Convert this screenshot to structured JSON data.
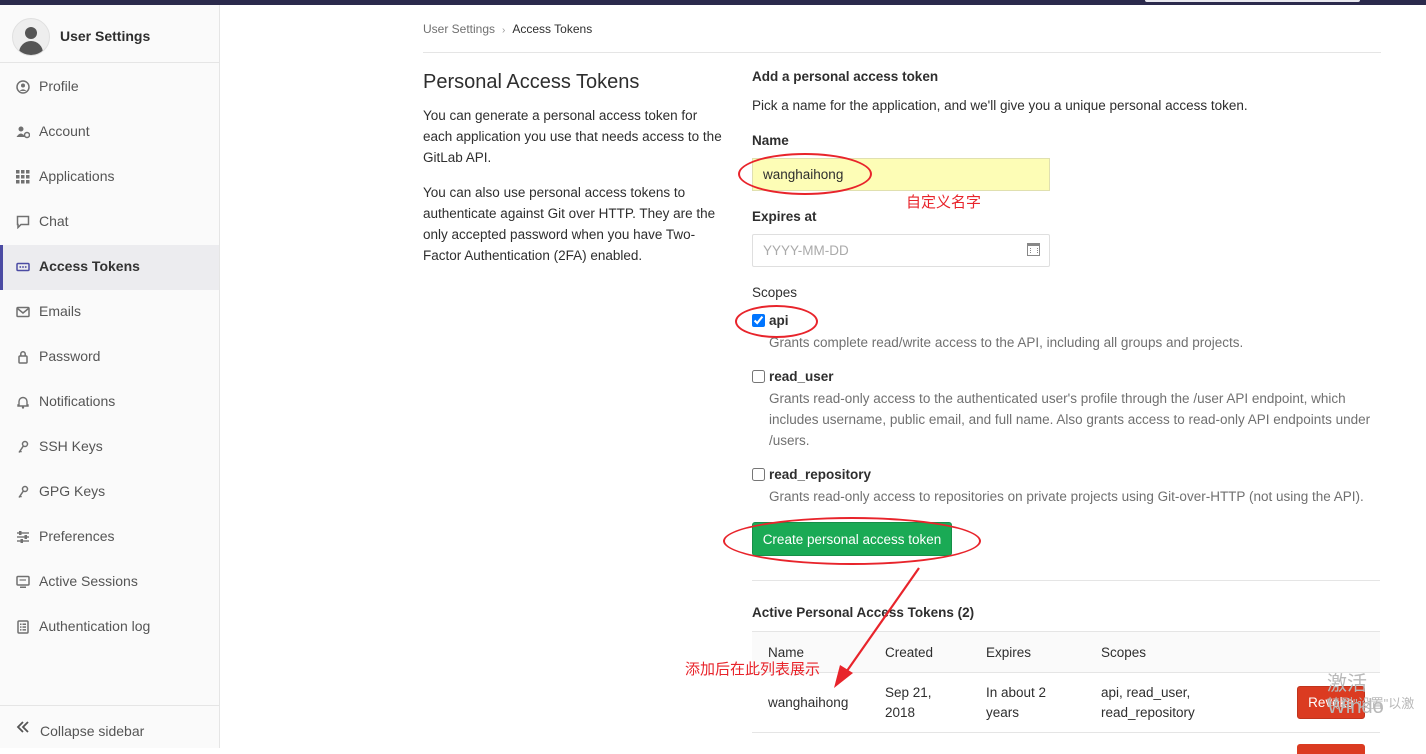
{
  "sidebar": {
    "title": "User Settings",
    "items": [
      {
        "label": "Profile",
        "icon": "user-circle-icon"
      },
      {
        "label": "Account",
        "icon": "users-gear-icon"
      },
      {
        "label": "Applications",
        "icon": "grid-icon"
      },
      {
        "label": "Chat",
        "icon": "comment-icon"
      },
      {
        "label": "Access Tokens",
        "icon": "token-icon",
        "active": true
      },
      {
        "label": "Emails",
        "icon": "envelope-icon"
      },
      {
        "label": "Password",
        "icon": "lock-icon"
      },
      {
        "label": "Notifications",
        "icon": "bell-icon"
      },
      {
        "label": "SSH Keys",
        "icon": "key-icon"
      },
      {
        "label": "GPG Keys",
        "icon": "key-icon"
      },
      {
        "label": "Preferences",
        "icon": "sliders-icon"
      },
      {
        "label": "Active Sessions",
        "icon": "monitor-icon"
      },
      {
        "label": "Authentication log",
        "icon": "list-icon"
      }
    ],
    "collapse_label": "Collapse sidebar"
  },
  "breadcrumb": {
    "parent": "User Settings",
    "current": "Access Tokens"
  },
  "intro": {
    "title": "Personal Access Tokens",
    "p1": "You can generate a personal access token for each application you use that needs access to the GitLab API.",
    "p2": "You can also use personal access tokens to authenticate against Git over HTTP. They are the only accepted password when you have Two-Factor Authentication (2FA) enabled."
  },
  "form": {
    "heading": "Add a personal access token",
    "subtitle": "Pick a name for the application, and we'll give you a unique personal access token.",
    "name_label": "Name",
    "name_value": "wanghaihong",
    "expires_label": "Expires at",
    "expires_placeholder": "YYYY-MM-DD",
    "scopes_label": "Scopes",
    "scopes": [
      {
        "name": "api",
        "checked": true,
        "help": "Grants complete read/write access to the API, including all groups and projects."
      },
      {
        "name": "read_user",
        "checked": false,
        "help": "Grants read-only access to the authenticated user's profile through the /user API endpoint, which includes username, public email, and full name. Also grants access to read-only API endpoints under /users."
      },
      {
        "name": "read_repository",
        "checked": false,
        "help": "Grants read-only access to repositories on private projects using Git-over-HTTP (not using the API)."
      }
    ],
    "submit_label": "Create personal access token"
  },
  "active_tokens": {
    "heading": "Active Personal Access Tokens (2)",
    "columns": [
      "Name",
      "Created",
      "Expires",
      "Scopes"
    ],
    "rows": [
      {
        "name": "wanghaihong",
        "created": "Sep 21, 2018",
        "expires": "In about 2 years",
        "scopes": "api, read_user, read_repository",
        "action": "Revoke"
      }
    ]
  },
  "annotations": {
    "name_note": "自定义名字",
    "list_note": "添加后在此列表展示",
    "color": "#e8242b"
  },
  "watermark": {
    "line1": "激活 Windo",
    "line2": "转到\"设置\"以激"
  },
  "colors": {
    "primary_button": "#1aaa55",
    "danger_button": "#db3b21",
    "active_indicator": "#4b4ba3",
    "topbar": "#2b2a4c"
  }
}
